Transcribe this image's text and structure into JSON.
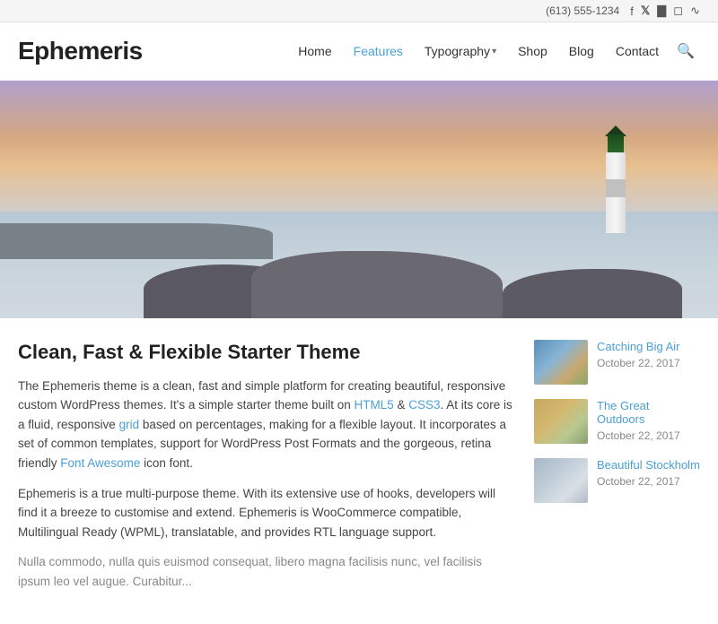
{
  "topbar": {
    "phone": "(613) 555-1234",
    "icons": [
      "phone-icon",
      "facebook-icon",
      "twitter-icon",
      "instagram-icon",
      "vimeo-icon",
      "rss-icon"
    ]
  },
  "header": {
    "logo": "Ephemeris",
    "nav": [
      {
        "label": "Home",
        "active": false,
        "has_dropdown": false
      },
      {
        "label": "Features",
        "active": true,
        "has_dropdown": false
      },
      {
        "label": "Typography",
        "active": false,
        "has_dropdown": true
      },
      {
        "label": "Shop",
        "active": false,
        "has_dropdown": false
      },
      {
        "label": "Blog",
        "active": false,
        "has_dropdown": false
      },
      {
        "label": "Contact",
        "active": false,
        "has_dropdown": false
      }
    ]
  },
  "hero": {
    "alt": "Lighthouse at sunset"
  },
  "post": {
    "title": "Clean, Fast & Flexible Starter Theme",
    "paragraph1": "The Ephemeris theme is a clean, fast and simple platform for creating beautiful, responsive custom WordPress themes. It's a simple starter theme built on HTML5 & CSS3. At its core is a fluid, responsive grid based on percentages, making for a flexible layout. It incorporates a set of common templates, support for WordPress Post Formats and the gorgeous, retina friendly Font Awesome icon font.",
    "paragraph2": "Ephemeris is a true multi-purpose theme. With its extensive use of hooks, developers will find it a breeze to customise and extend. Ephemeris is WooCommerce compatible, Multilingual Ready (WPML), translatable, and provides RTL language support.",
    "paragraph3": "Nulla commodo, nulla quis euismod consequat, libero magna facilisis nunc, vel facilisis ipsum leo vel augue. Curabitur..."
  },
  "sidebar": {
    "items": [
      {
        "title": "Catching Big Air",
        "date": "October 22, 2017",
        "thumb_type": "thumb1"
      },
      {
        "title": "The Great Outdoors",
        "date": "October 22, 2017",
        "thumb_type": "thumb2"
      },
      {
        "title": "Beautiful Stockholm",
        "date": "October 22, 2017",
        "thumb_type": "thumb3"
      }
    ]
  },
  "links": {
    "html5": "HTML5",
    "css3": "CSS3",
    "grid": "grid",
    "font_awesome": "Font Awesome"
  }
}
